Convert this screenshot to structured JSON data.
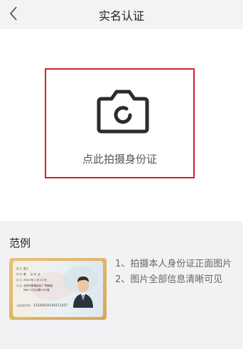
{
  "header": {
    "title": "实名认证",
    "back_icon": "chevron-left-icon"
  },
  "upload": {
    "hint": "点此拍摄身份证",
    "camera_icon": "camera-icon",
    "frame_color": "#d8202a"
  },
  "example": {
    "title": "范例",
    "notes": [
      "1、拍摄本人身份证正面图片",
      "2、图片全部信息清晰可见"
    ],
    "card": {
      "name_label": "姓 名",
      "name": "张三",
      "sex_label": "性 别",
      "sex": "男",
      "ethnic_label": "民 族",
      "ethnic": "汉",
      "birth_label": "出 生",
      "birth": "2010 年 1 月 11 日",
      "address_label": "住 址",
      "address_line1": "北京市西城区西 广场就酒",
      "address_line2": "Mall 11办公楼1102室",
      "id_label": "公民身份号码",
      "id_number": "12345620100111457"
    }
  }
}
